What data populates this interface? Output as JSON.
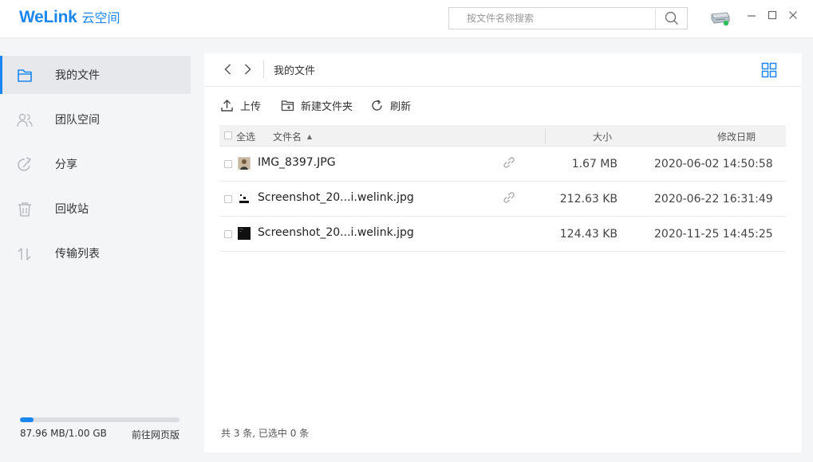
{
  "app": {
    "logo_main": "WeLink",
    "logo_sub": "云空间"
  },
  "search": {
    "placeholder": "按文件名称搜索",
    "value": ""
  },
  "sidebar": {
    "items": [
      {
        "label": "我的文件",
        "icon": "folder-icon",
        "active": true
      },
      {
        "label": "团队空间",
        "icon": "team-icon",
        "active": false
      },
      {
        "label": "分享",
        "icon": "share-icon",
        "active": false
      },
      {
        "label": "回收站",
        "icon": "trash-icon",
        "active": false
      },
      {
        "label": "传输列表",
        "icon": "transfer-icon",
        "active": false
      }
    ],
    "storage_used": "87.96 MB/1.00 GB",
    "storage_fraction": 0.086,
    "web_link": "前往网页版"
  },
  "main": {
    "breadcrumb": "我的文件",
    "toolbar": {
      "upload": "上传",
      "new_folder": "新建文件夹",
      "refresh": "刷新"
    },
    "table": {
      "select_all": "全选",
      "col_name": "文件名",
      "sort_indicator": "▲",
      "col_size": "大小",
      "col_date": "修改日期",
      "rows": [
        {
          "name": "IMG_8397.JPG",
          "size": "1.67 MB",
          "date": "2020-06-02 14:50:58",
          "shared": true,
          "thumb": "photo"
        },
        {
          "name": "Screenshot_20...i.welink.jpg",
          "size": "212.63 KB",
          "date": "2020-06-22 16:31:49",
          "shared": true,
          "thumb": "screenshot-light"
        },
        {
          "name": "Screenshot_20...i.welink.jpg",
          "size": "124.43 KB",
          "date": "2020-11-25 14:45:25",
          "shared": false,
          "thumb": "screenshot-dark"
        }
      ]
    },
    "footer": "共 3 条, 已选中 0 条"
  },
  "colors": {
    "accent": "#1a86f0",
    "sidebar_bg": "#f4f5f7",
    "active_item_bg": "#e6e8ec"
  }
}
